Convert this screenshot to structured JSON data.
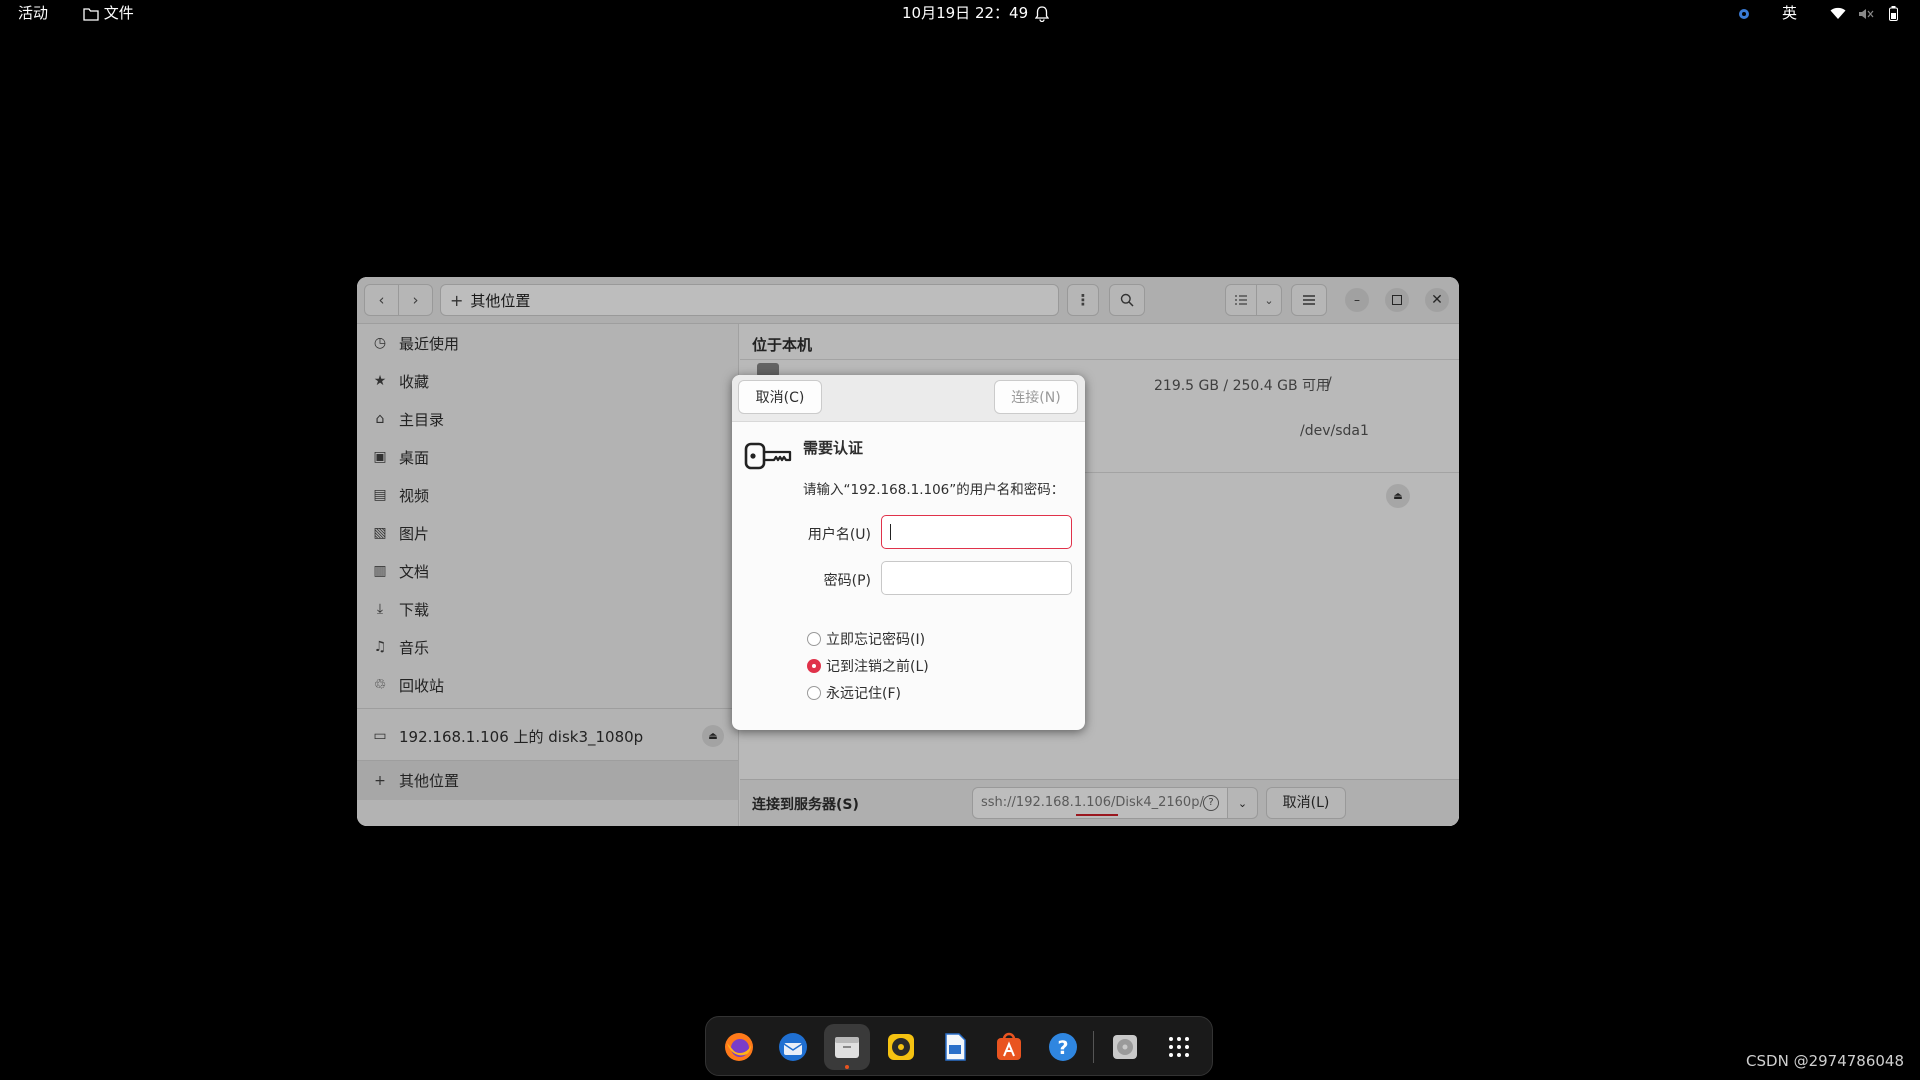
{
  "topbar": {
    "activities": "活动",
    "app_menu": "文件",
    "datetime": "10月19日 22：49",
    "input_method": "英"
  },
  "window": {
    "path_label": "其他位置",
    "sidebar": {
      "items": [
        {
          "label": "最近使用",
          "icon": "clock-icon"
        },
        {
          "label": "收藏",
          "icon": "star-icon"
        },
        {
          "label": "主目录",
          "icon": "home-icon"
        },
        {
          "label": "桌面",
          "icon": "desktop-icon"
        },
        {
          "label": "视频",
          "icon": "video-icon"
        },
        {
          "label": "图片",
          "icon": "image-icon"
        },
        {
          "label": "文档",
          "icon": "document-icon"
        },
        {
          "label": "下载",
          "icon": "download-icon"
        },
        {
          "label": "音乐",
          "icon": "music-icon"
        },
        {
          "label": "回收站",
          "icon": "trash-icon"
        }
      ],
      "network_mount": "192.168.1.106 上的 disk3_1080p",
      "other_locations": "其他位置"
    },
    "main": {
      "section_title": "位于本机",
      "disk_usage": "219.5 GB / 250.4 GB 可用",
      "disk_mount": "/",
      "disk_device": "/dev/sda1",
      "connect_label": "连接到服务器(S)",
      "server_address": "ssh://192.168.1.106/Disk4_2160p/",
      "cancel_button": "取消(L)"
    }
  },
  "dialog": {
    "cancel_button": "取消(C)",
    "connect_button": "连接(N)",
    "title": "需要认证",
    "message": "请输入“192.168.1.106”的用户名和密码：",
    "username_label": "用户名(U)",
    "username_value": "",
    "password_label": "密码(P)",
    "password_value": "",
    "remember_options": [
      {
        "label": "立即忘记密码(I)",
        "selected": false
      },
      {
        "label": "记到注销之前(L)",
        "selected": true
      },
      {
        "label": "永远记住(F)",
        "selected": false
      }
    ]
  },
  "dock": {
    "apps": [
      "firefox-icon",
      "thunderbird-icon",
      "files-icon",
      "rhythmbox-icon",
      "writer-icon",
      "app-center-icon",
      "help-icon",
      "disc-icon",
      "show-apps-icon"
    ]
  },
  "watermark": "CSDN @2974786048",
  "colors": {
    "accent": "#e0324a",
    "dock_background": "#1a1a1a"
  }
}
